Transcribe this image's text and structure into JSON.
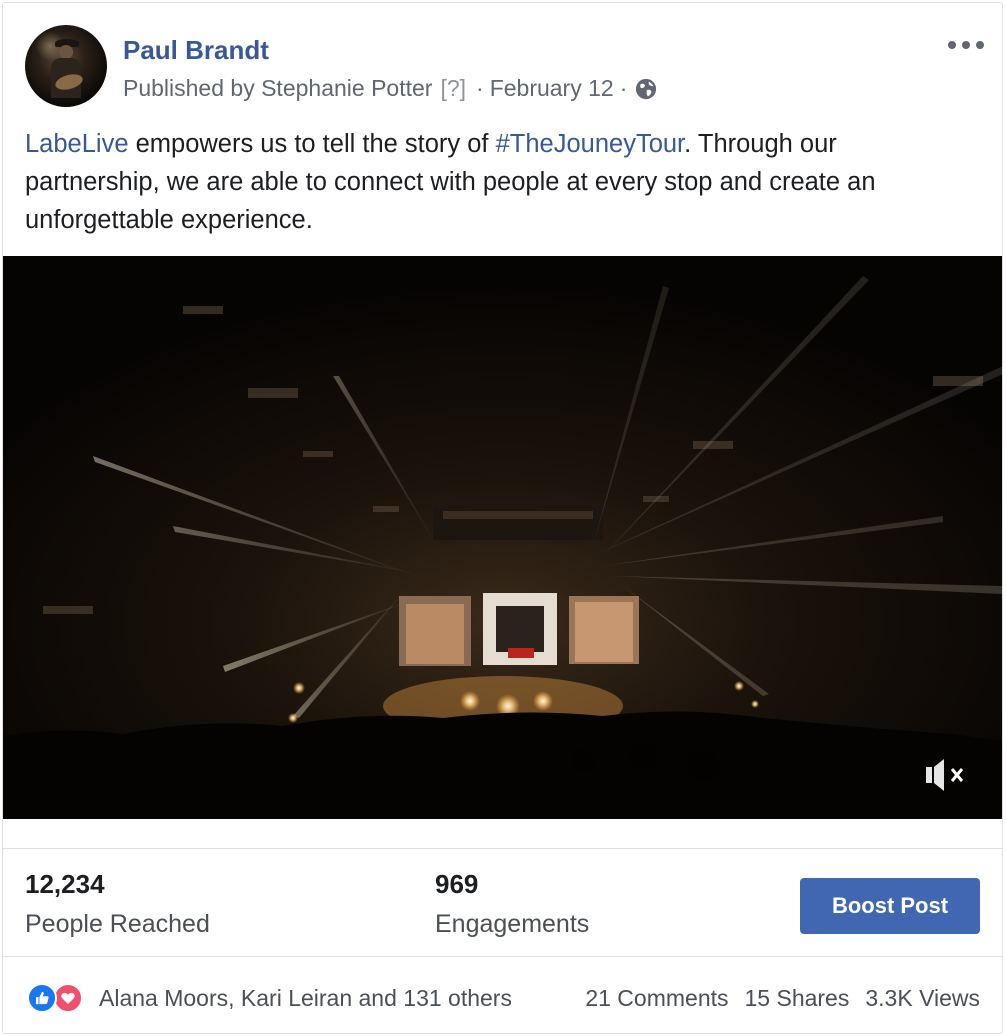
{
  "post": {
    "page_name": "Paul Brandt",
    "published_by": "Published by Stephanie Potter",
    "help_marker": "[?]",
    "separator": "·",
    "date": "February 12",
    "text": {
      "link1": "LabeLive",
      "part1": " empowers us to tell the story of ",
      "hashtag": "#TheJouneyTour",
      "part2": ". Through our partnership, we are able to connect with people at every stop and create an unforgettable experience."
    }
  },
  "stats": {
    "reached_value": "12,234",
    "reached_label": "People Reached",
    "engagements_value": "969",
    "engagements_label": "Engagements",
    "boost_label": "Boost Post"
  },
  "reactions": {
    "names": "Alana Moors, Kari Leiran and 131 others",
    "comments": "21 Comments",
    "shares": "15 Shares",
    "views": "3.3K Views"
  },
  "icons": {
    "more": "more-options-icon",
    "privacy": "globe-icon",
    "mute": "muted-speaker-icon",
    "like": "like-icon",
    "love": "love-icon"
  },
  "colors": {
    "link": "#385898",
    "boost": "#4267b2",
    "like": "#1877f2",
    "love": "#f0506e"
  }
}
